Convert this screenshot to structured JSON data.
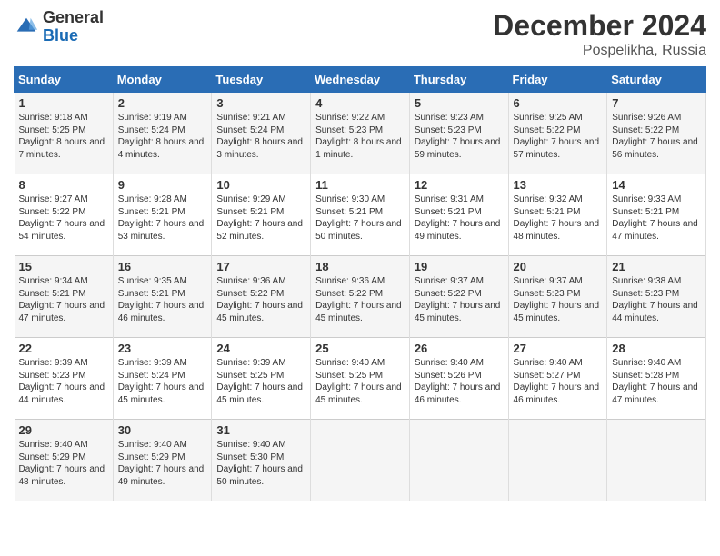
{
  "header": {
    "logo_general": "General",
    "logo_blue": "Blue",
    "month_title": "December 2024",
    "location": "Pospelikha, Russia"
  },
  "days_of_week": [
    "Sunday",
    "Monday",
    "Tuesday",
    "Wednesday",
    "Thursday",
    "Friday",
    "Saturday"
  ],
  "weeks": [
    [
      {
        "day": "1",
        "sunrise": "Sunrise: 9:18 AM",
        "sunset": "Sunset: 5:25 PM",
        "daylight": "Daylight: 8 hours and 7 minutes."
      },
      {
        "day": "2",
        "sunrise": "Sunrise: 9:19 AM",
        "sunset": "Sunset: 5:24 PM",
        "daylight": "Daylight: 8 hours and 4 minutes."
      },
      {
        "day": "3",
        "sunrise": "Sunrise: 9:21 AM",
        "sunset": "Sunset: 5:24 PM",
        "daylight": "Daylight: 8 hours and 3 minutes."
      },
      {
        "day": "4",
        "sunrise": "Sunrise: 9:22 AM",
        "sunset": "Sunset: 5:23 PM",
        "daylight": "Daylight: 8 hours and 1 minute."
      },
      {
        "day": "5",
        "sunrise": "Sunrise: 9:23 AM",
        "sunset": "Sunset: 5:23 PM",
        "daylight": "Daylight: 7 hours and 59 minutes."
      },
      {
        "day": "6",
        "sunrise": "Sunrise: 9:25 AM",
        "sunset": "Sunset: 5:22 PM",
        "daylight": "Daylight: 7 hours and 57 minutes."
      },
      {
        "day": "7",
        "sunrise": "Sunrise: 9:26 AM",
        "sunset": "Sunset: 5:22 PM",
        "daylight": "Daylight: 7 hours and 56 minutes."
      }
    ],
    [
      {
        "day": "8",
        "sunrise": "Sunrise: 9:27 AM",
        "sunset": "Sunset: 5:22 PM",
        "daylight": "Daylight: 7 hours and 54 minutes."
      },
      {
        "day": "9",
        "sunrise": "Sunrise: 9:28 AM",
        "sunset": "Sunset: 5:21 PM",
        "daylight": "Daylight: 7 hours and 53 minutes."
      },
      {
        "day": "10",
        "sunrise": "Sunrise: 9:29 AM",
        "sunset": "Sunset: 5:21 PM",
        "daylight": "Daylight: 7 hours and 52 minutes."
      },
      {
        "day": "11",
        "sunrise": "Sunrise: 9:30 AM",
        "sunset": "Sunset: 5:21 PM",
        "daylight": "Daylight: 7 hours and 50 minutes."
      },
      {
        "day": "12",
        "sunrise": "Sunrise: 9:31 AM",
        "sunset": "Sunset: 5:21 PM",
        "daylight": "Daylight: 7 hours and 49 minutes."
      },
      {
        "day": "13",
        "sunrise": "Sunrise: 9:32 AM",
        "sunset": "Sunset: 5:21 PM",
        "daylight": "Daylight: 7 hours and 48 minutes."
      },
      {
        "day": "14",
        "sunrise": "Sunrise: 9:33 AM",
        "sunset": "Sunset: 5:21 PM",
        "daylight": "Daylight: 7 hours and 47 minutes."
      }
    ],
    [
      {
        "day": "15",
        "sunrise": "Sunrise: 9:34 AM",
        "sunset": "Sunset: 5:21 PM",
        "daylight": "Daylight: 7 hours and 47 minutes."
      },
      {
        "day": "16",
        "sunrise": "Sunrise: 9:35 AM",
        "sunset": "Sunset: 5:21 PM",
        "daylight": "Daylight: 7 hours and 46 minutes."
      },
      {
        "day": "17",
        "sunrise": "Sunrise: 9:36 AM",
        "sunset": "Sunset: 5:22 PM",
        "daylight": "Daylight: 7 hours and 45 minutes."
      },
      {
        "day": "18",
        "sunrise": "Sunrise: 9:36 AM",
        "sunset": "Sunset: 5:22 PM",
        "daylight": "Daylight: 7 hours and 45 minutes."
      },
      {
        "day": "19",
        "sunrise": "Sunrise: 9:37 AM",
        "sunset": "Sunset: 5:22 PM",
        "daylight": "Daylight: 7 hours and 45 minutes."
      },
      {
        "day": "20",
        "sunrise": "Sunrise: 9:37 AM",
        "sunset": "Sunset: 5:23 PM",
        "daylight": "Daylight: 7 hours and 45 minutes."
      },
      {
        "day": "21",
        "sunrise": "Sunrise: 9:38 AM",
        "sunset": "Sunset: 5:23 PM",
        "daylight": "Daylight: 7 hours and 44 minutes."
      }
    ],
    [
      {
        "day": "22",
        "sunrise": "Sunrise: 9:39 AM",
        "sunset": "Sunset: 5:23 PM",
        "daylight": "Daylight: 7 hours and 44 minutes."
      },
      {
        "day": "23",
        "sunrise": "Sunrise: 9:39 AM",
        "sunset": "Sunset: 5:24 PM",
        "daylight": "Daylight: 7 hours and 45 minutes."
      },
      {
        "day": "24",
        "sunrise": "Sunrise: 9:39 AM",
        "sunset": "Sunset: 5:25 PM",
        "daylight": "Daylight: 7 hours and 45 minutes."
      },
      {
        "day": "25",
        "sunrise": "Sunrise: 9:40 AM",
        "sunset": "Sunset: 5:25 PM",
        "daylight": "Daylight: 7 hours and 45 minutes."
      },
      {
        "day": "26",
        "sunrise": "Sunrise: 9:40 AM",
        "sunset": "Sunset: 5:26 PM",
        "daylight": "Daylight: 7 hours and 46 minutes."
      },
      {
        "day": "27",
        "sunrise": "Sunrise: 9:40 AM",
        "sunset": "Sunset: 5:27 PM",
        "daylight": "Daylight: 7 hours and 46 minutes."
      },
      {
        "day": "28",
        "sunrise": "Sunrise: 9:40 AM",
        "sunset": "Sunset: 5:28 PM",
        "daylight": "Daylight: 7 hours and 47 minutes."
      }
    ],
    [
      {
        "day": "29",
        "sunrise": "Sunrise: 9:40 AM",
        "sunset": "Sunset: 5:29 PM",
        "daylight": "Daylight: 7 hours and 48 minutes."
      },
      {
        "day": "30",
        "sunrise": "Sunrise: 9:40 AM",
        "sunset": "Sunset: 5:29 PM",
        "daylight": "Daylight: 7 hours and 49 minutes."
      },
      {
        "day": "31",
        "sunrise": "Sunrise: 9:40 AM",
        "sunset": "Sunset: 5:30 PM",
        "daylight": "Daylight: 7 hours and 50 minutes."
      },
      null,
      null,
      null,
      null
    ]
  ]
}
